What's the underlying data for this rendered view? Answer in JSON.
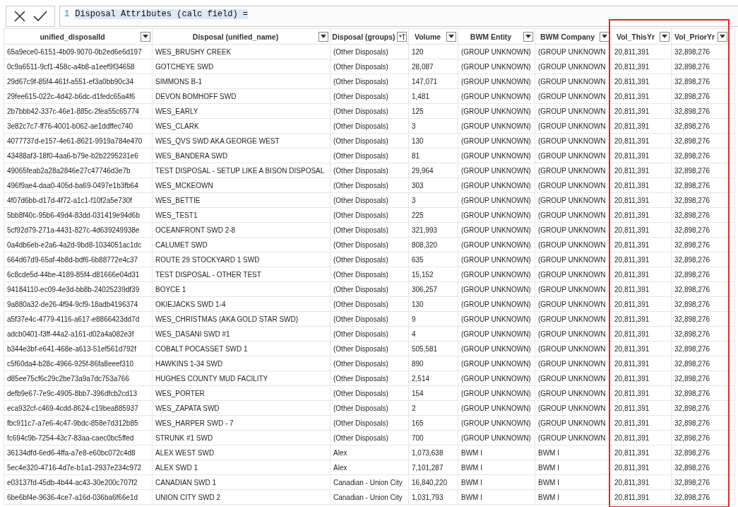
{
  "formula_bar": {
    "line_number": "1",
    "formula": "Disposal Attributes (calc field) ="
  },
  "table": {
    "columns": [
      {
        "label": "unified_disposalId",
        "sorted": false
      },
      {
        "label": "Disposal (unified_name)",
        "sorted": false
      },
      {
        "label": "Disposal (groups)",
        "sorted": true
      },
      {
        "label": "Volume",
        "sorted": false
      },
      {
        "label": "BWM Entity",
        "sorted": false
      },
      {
        "label": "BWM Company",
        "sorted": false
      },
      {
        "label": "Vol_ThisYr",
        "sorted": false
      },
      {
        "label": "Vol_PriorYr",
        "sorted": false
      }
    ],
    "rows": [
      [
        "65a9ece0-6151-4b09-9070-0b2ed6e6d197",
        "WES_BRUSHY CREEK",
        "(Other Disposals)",
        "120",
        "(GROUP UNKNOWN)",
        "(GROUP UNKNOWN",
        "20,811,391",
        "32,898,276"
      ],
      [
        "0c9a6511-9cf1-458c-a4b8-a1eef9f34658",
        "GOTCHEYE SWD",
        "(Other Disposals)",
        "28,087",
        "(GROUP UNKNOWN)",
        "(GROUP UNKNOWN",
        "20,811,391",
        "32,898,276"
      ],
      [
        "29d67c9f-85f4-461f-a551-ef3a0bb90c34",
        "SIMMONS B-1",
        "(Other Disposals)",
        "147,071",
        "(GROUP UNKNOWN)",
        "(GROUP UNKNOWN",
        "20,811,391",
        "32,898,276"
      ],
      [
        "29fee615-022c-4d42-b6dc-d1fedc65a4f6",
        "DEVON BOMHOFF SWD",
        "(Other Disposals)",
        "1,481",
        "(GROUP UNKNOWN)",
        "(GROUP UNKNOWN",
        "20,811,391",
        "32,898,276"
      ],
      [
        "2b7bbb42-337c-46e1-885c-2fea55c65774",
        "WES_EARLY",
        "(Other Disposals)",
        "125",
        "(GROUP UNKNOWN)",
        "(GROUP UNKNOWN",
        "20,811,391",
        "32,898,276"
      ],
      [
        "3e82c7c7-ff76-4001-b062-ae1ddffec740",
        "WES_CLARK",
        "(Other Disposals)",
        "3",
        "(GROUP UNKNOWN)",
        "(GROUP UNKNOWN",
        "20,811,391",
        "32,898,276"
      ],
      [
        "4077737d-e157-4e61-8621-9919a784e470",
        "WES_QVS SWD AKA GEORGE WEST",
        "(Other Disposals)",
        "130",
        "(GROUP UNKNOWN)",
        "(GROUP UNKNOWN",
        "20,811,391",
        "32,898,276"
      ],
      [
        "43488af3-18f0-4aa6-b79e-b2b2295231e6",
        "WES_BANDERA SWD",
        "(Other Disposals)",
        "81",
        "(GROUP UNKNOWN)",
        "(GROUP UNKNOWN",
        "20,811,391",
        "32,898,276"
      ],
      [
        "49065feab2a28a2846e27c47746d3e7b",
        "TEST DISPOSAL - SETUP LIKE A BISON DISPOSAL",
        "(Other Disposals)",
        "29,964",
        "(GROUP UNKNOWN)",
        "(GROUP UNKNOWN",
        "20,811,391",
        "32,898,276"
      ],
      [
        "496f9ae4-daa0-405d-ba69-0497e1b3fb64",
        "WES_MCKEOWN",
        "(Other Disposals)",
        "303",
        "(GROUP UNKNOWN)",
        "(GROUP UNKNOWN",
        "20,811,391",
        "32,898,276"
      ],
      [
        "4f07d6bb-d17d-4f72-a1c1-f10f2a5e730f",
        "WES_BETTIE",
        "(Other Disposals)",
        "3",
        "(GROUP UNKNOWN)",
        "(GROUP UNKNOWN",
        "20,811,391",
        "32,898,276"
      ],
      [
        "5bb8f40c-95b6-49d4-83dd-031419e94d6b",
        "WES_TEST1",
        "(Other Disposals)",
        "225",
        "(GROUP UNKNOWN)",
        "(GROUP UNKNOWN",
        "20,811,391",
        "32,898,276"
      ],
      [
        "5cf92d79-271a-4431-827c-4d639249938e",
        "OCEANFRONT SWD 2-8",
        "(Other Disposals)",
        "321,993",
        "(GROUP UNKNOWN)",
        "(GROUP UNKNOWN",
        "20,811,391",
        "32,898,276"
      ],
      [
        "0a4db6eb-e2a6-4a2d-9bd8-1034051ac1dc",
        "CALUMET SWD",
        "(Other Disposals)",
        "808,320",
        "(GROUP UNKNOWN)",
        "(GROUP UNKNOWN",
        "20,811,391",
        "32,898,276"
      ],
      [
        "664d67d9-65af-4b8d-bdf6-6b88772e4c37",
        "ROUTE 29 STOCKYARD 1 SWD",
        "(Other Disposals)",
        "635",
        "(GROUP UNKNOWN)",
        "(GROUP UNKNOWN",
        "20,811,391",
        "32,898,276"
      ],
      [
        "6c8cde5d-44be-4189-85f4-d81666e04d31",
        "TEST DISPOSAL - OTHER TEST",
        "(Other Disposals)",
        "15,152",
        "(GROUP UNKNOWN)",
        "(GROUP UNKNOWN",
        "20,811,391",
        "32,898,276"
      ],
      [
        "94184110-ec09-4e3d-bb8b-24025239df39",
        "BOYCE 1",
        "(Other Disposals)",
        "306,257",
        "(GROUP UNKNOWN)",
        "(GROUP UNKNOWN",
        "20,811,391",
        "32,898,276"
      ],
      [
        "9a880a32-de26-4f94-9cf9-18adb4196374",
        "OKIEJACKS SWD 1-4",
        "(Other Disposals)",
        "130",
        "(GROUP UNKNOWN)",
        "(GROUP UNKNOWN",
        "20,811,391",
        "32,898,276"
      ],
      [
        "a5f37e4c-4779-4116-a617-e8866423dd7d",
        "WES_CHRISTMAS (AKA GOLD STAR SWD)",
        "(Other Disposals)",
        "9",
        "(GROUP UNKNOWN)",
        "(GROUP UNKNOWN",
        "20,811,391",
        "32,898,276"
      ],
      [
        "adcb0401-f3ff-44a2-a161-d02a4a082e3f",
        "WES_DASANI SWD #1",
        "(Other Disposals)",
        "4",
        "(GROUP UNKNOWN)",
        "(GROUP UNKNOWN",
        "20,811,391",
        "32,898,276"
      ],
      [
        "b344e3bf-e641-468e-a613-51ef561d792f",
        "COBALT POCASSET SWD 1",
        "(Other Disposals)",
        "505,581",
        "(GROUP UNKNOWN)",
        "(GROUP UNKNOWN",
        "20,811,391",
        "32,898,276"
      ],
      [
        "c5f60da4-b28c-4966-925f-86fa8eeef310",
        "HAWKINS 1-34 SWD",
        "(Other Disposals)",
        "890",
        "(GROUP UNKNOWN)",
        "(GROUP UNKNOWN",
        "20,811,391",
        "32,898,276"
      ],
      [
        "d85ee75cf6c29c2be73a9a7dc753a766",
        "HUGHES COUNTY MUD FACILITY",
        "(Other Disposals)",
        "2,514",
        "(GROUP UNKNOWN)",
        "(GROUP UNKNOWN",
        "20,811,391",
        "32,898,276"
      ],
      [
        "defb9e67-7e9c-4905-8bb7-396dfcb2cd13",
        "WES_PORTER",
        "(Other Disposals)",
        "154",
        "(GROUP UNKNOWN)",
        "(GROUP UNKNOWN",
        "20,811,391",
        "32,898,276"
      ],
      [
        "eca932cf-c469-4cdd-8624-c19bea885937",
        "WES_ZAPATA SWD",
        "(Other Disposals)",
        "2",
        "(GROUP UNKNOWN)",
        "(GROUP UNKNOWN",
        "20,811,391",
        "32,898,276"
      ],
      [
        "fbc911c7-a7e6-4c47-9bdc-858e7d312b85",
        "WES_HARPER SWD - 7",
        "(Other Disposals)",
        "165",
        "(GROUP UNKNOWN)",
        "(GROUP UNKNOWN",
        "20,811,391",
        "32,898,276"
      ],
      [
        "fc694c9b-7254-43c7-83aa-caec0bc5ffed",
        "STRUNK #1 SWD",
        "(Other Disposals)",
        "700",
        "(GROUP UNKNOWN)",
        "(GROUP UNKNOWN",
        "20,811,391",
        "32,898,276"
      ],
      [
        "36134dfd-6ed6-4ffa-a7e8-e60bc072c4d8",
        "ALEX WEST SWD",
        "Alex",
        "1,073,638",
        "BWM I",
        "BWM I",
        "20,811,391",
        "32,898,276"
      ],
      [
        "5ec4e320-4716-4d7e-b1a1-2937e234c972",
        "ALEX SWD 1",
        "Alex",
        "7,101,287",
        "BWM I",
        "BWM I",
        "20,811,391",
        "32,898,276"
      ],
      [
        "e03137fd-45db-4b44-ac43-30e200c707f2",
        "CANADIAN SWD 1",
        "Canadian - Union City",
        "16,840,220",
        "BWM I",
        "BWM I",
        "20,811,391",
        "32,898,276"
      ],
      [
        "6be6bf4e-9636-4ce7-a16d-036ba6f66e1d",
        "UNION CITY SWD 2",
        "Canadian - Union City",
        "1,031,793",
        "BWM I",
        "BWM I",
        "20,811,391",
        "32,898,276"
      ]
    ]
  }
}
